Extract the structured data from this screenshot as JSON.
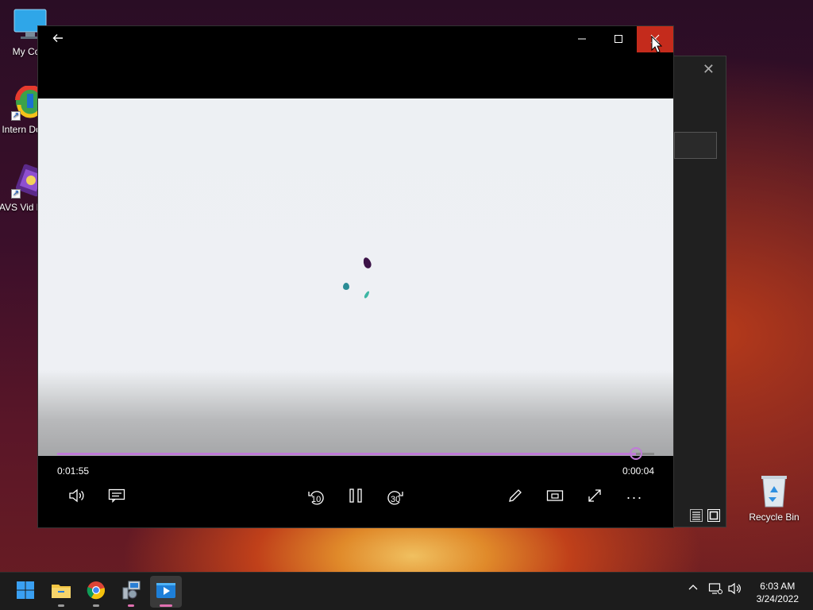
{
  "desktop": {
    "icons": [
      {
        "label": "My Com",
        "icon": "computer-icon"
      },
      {
        "label": "Intern Downl",
        "icon": "internet-download-manager-icon"
      },
      {
        "label": "AVS Vid Edito",
        "icon": "avs-video-editor-icon"
      },
      {
        "label": "Recycle Bin",
        "icon": "recycle-bin-icon"
      }
    ]
  },
  "player": {
    "back_icon": "back-arrow-icon",
    "minimize_icon": "minimize-icon",
    "maximize_icon": "maximize-icon",
    "close_icon": "close-icon",
    "current_time": "0:01:55",
    "remaining_time": "0:00:04",
    "progress_fraction": 0.97,
    "accent": "#c07ad8",
    "controls": {
      "volume": "volume-icon",
      "captions": "captions-icon",
      "skip_back_label": "10",
      "play_pause": "pause-icon",
      "skip_forward_label": "30",
      "edit": "pen-icon",
      "miniplayer": "miniplayer-icon",
      "fullscreen": "fullscreen-icon",
      "more": "···"
    }
  },
  "taskbar": {
    "items": [
      "windows-start-icon",
      "file-explorer-icon",
      "chrome-icon",
      "network-tool-icon",
      "media-player-icon"
    ],
    "tray": [
      "chevron-up-icon",
      "network-icon",
      "volume-icon"
    ],
    "time": "6:03 AM",
    "date": "3/24/2022"
  }
}
